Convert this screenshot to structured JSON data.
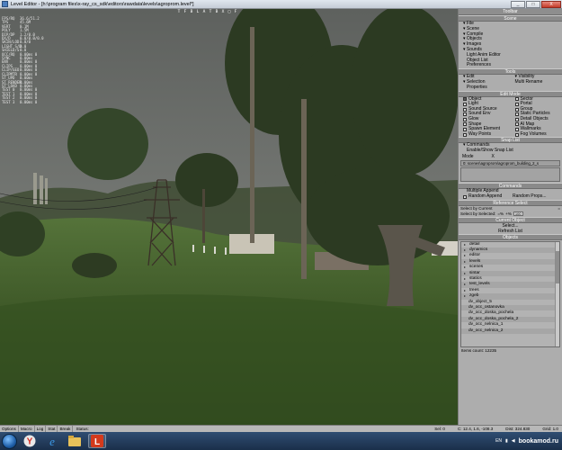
{
  "window": {
    "title": "Level Editor - [h:\\program files\\x-ray_cs_sdk\\editors\\rawdata\\levels\\agroprom.level*]",
    "min": "_",
    "max": "□",
    "close": "X"
  },
  "viewport": {
    "toolbar": [
      "T",
      "F",
      "B",
      "L",
      "A",
      "T",
      "B",
      "X",
      "□",
      "F"
    ],
    "stats": [
      {
        "k": "FPS/RQ",
        "v": "36.6/51.2"
      },
      {
        "k": "TPS",
        "v": "45.6M"
      },
      {
        "k": "VERT",
        "v": "0.1M"
      },
      {
        "k": "POLY",
        "v": "1.5M"
      },
      {
        "k": "DIP/DP",
        "v": "1.2/0.0"
      },
      {
        "k": "DX/D",
        "v": "0.0/0.0/0.0"
      },
      {
        "k": "SKIN/LOD",
        "v": "0.0/0"
      },
      {
        "k": "LIGHT S/D",
        "v": "0.0"
      },
      {
        "k": "SHIELD/S",
        "v": "0.0"
      },
      {
        "k": "OCC/RQ",
        "v": "0.00ms 0"
      },
      {
        "k": "",
        "v": ""
      },
      {
        "k": "SYNC",
        "v": "0.00ms"
      },
      {
        "k": "ENV",
        "v": "0.00ms 0"
      },
      {
        "k": "CLIPS",
        "v": "0.00ms 0"
      },
      {
        "k": "CLIP/GEO",
        "v": "0.00ms 0"
      },
      {
        "k": "CLIPMTR",
        "v": "0.00ms 0"
      },
      {
        "k": "",
        "v": ""
      },
      {
        "k": "ST_UPD",
        "v": "0.00ms"
      },
      {
        "k": "ST_RENDER",
        "v": "0.00ms"
      },
      {
        "k": "ST_LOAD",
        "v": "0.00ms"
      },
      {
        "k": "",
        "v": ""
      },
      {
        "k": "TEST 0",
        "v": "0.00ms 0"
      },
      {
        "k": "TEST 1",
        "v": "0.00ms 0"
      },
      {
        "k": "TEST 2",
        "v": "0.00ms 0"
      },
      {
        "k": "TEST 3",
        "v": "0.00ms 0"
      }
    ]
  },
  "panel": {
    "toolbar_title": "Toolbar",
    "scene_head": "Scene",
    "scene_items": [
      "File",
      "Scene",
      "Compile",
      "Objects",
      "Images",
      "Sounds"
    ],
    "scene_plain": [
      "Light Anim Editor",
      "Object List",
      "Preferences"
    ],
    "tools_head": "Tools",
    "tools_edit": "Edit",
    "tools_visibility": "Visibility",
    "tools_selection": "Selection",
    "tools_multirename": "Multi Rename",
    "tools_properties": "Properties",
    "editmode_head": "Edit Mode",
    "editmode_left": [
      "Object",
      "Light",
      "Sound Source",
      "Sound Env",
      "Glow",
      "Shape",
      "Spawn Element",
      "Way Points"
    ],
    "editmode_right": [
      "Sector",
      "Portal",
      "Group",
      "Static Particles",
      "Detail Objects",
      "AI Map",
      "Wallmarks",
      "Fog Volumes"
    ],
    "snaplist_head": "Snap List",
    "snap_commands": "Commands",
    "snap_enable": "Enable/Show Snap List",
    "snap_mode": "Mode",
    "snap_mode_x": "X",
    "snap_path": "0: scenes\\agroprom\\agroprom_building_2_s",
    "commands_head": "Commands",
    "commands_multiple": "Multiple Append",
    "commands_random": "Random Append",
    "commands_random_props": "Random Props...",
    "ref_head": "Reference Select",
    "ref_current": "Select by Current",
    "ref_current_btn": "=",
    "ref_selected": "Select by Selected:",
    "ref_sel_a": "=%",
    "ref_sel_b": "+%",
    "ref_pct": "100",
    "current_head": "Current Object",
    "current_select": "Select...",
    "current_refresh": "Refresh List",
    "objects_head": "Objects",
    "tree": [
      {
        "label": "detail",
        "child": false
      },
      {
        "label": "dynamics",
        "child": false
      },
      {
        "label": "editor",
        "child": false
      },
      {
        "label": "levels",
        "child": false
      },
      {
        "label": "scenes",
        "child": false
      },
      {
        "label": "sintar",
        "child": false
      },
      {
        "label": "statics",
        "child": false
      },
      {
        "label": "test_levels",
        "child": false
      },
      {
        "label": "trees",
        "child": false
      },
      {
        "label": "zgeb",
        "child": false
      },
      {
        "label": "dv_object_5",
        "child": true
      },
      {
        "label": "dv_occ_ostanovka",
        "child": true
      },
      {
        "label": "dv_occ_doska_pochela",
        "child": true
      },
      {
        "label": "dv_occ_doska_pochela_2",
        "child": true
      },
      {
        "label": "dv_occ_nelnica_1",
        "child": true
      },
      {
        "label": "dv_occ_nelnica_2",
        "child": true
      }
    ],
    "items_count": "Items count: 12235"
  },
  "statusbar": {
    "buttons": [
      "Options",
      "Macro",
      "Log",
      "Stat",
      "Break"
    ],
    "status": "Status:",
    "coord": "C: 12.4, 1.6, -108.3",
    "sel": "Sel: 0",
    "dist": "Dist: 324.830",
    "grid": "Grid: 1.0"
  },
  "taskbar": {
    "lang": "EN",
    "watermark": "bookamod.ru"
  },
  "colors": {
    "sky": "#6e716d",
    "grass": "#3f5a27",
    "tree": "#2e3b22"
  }
}
